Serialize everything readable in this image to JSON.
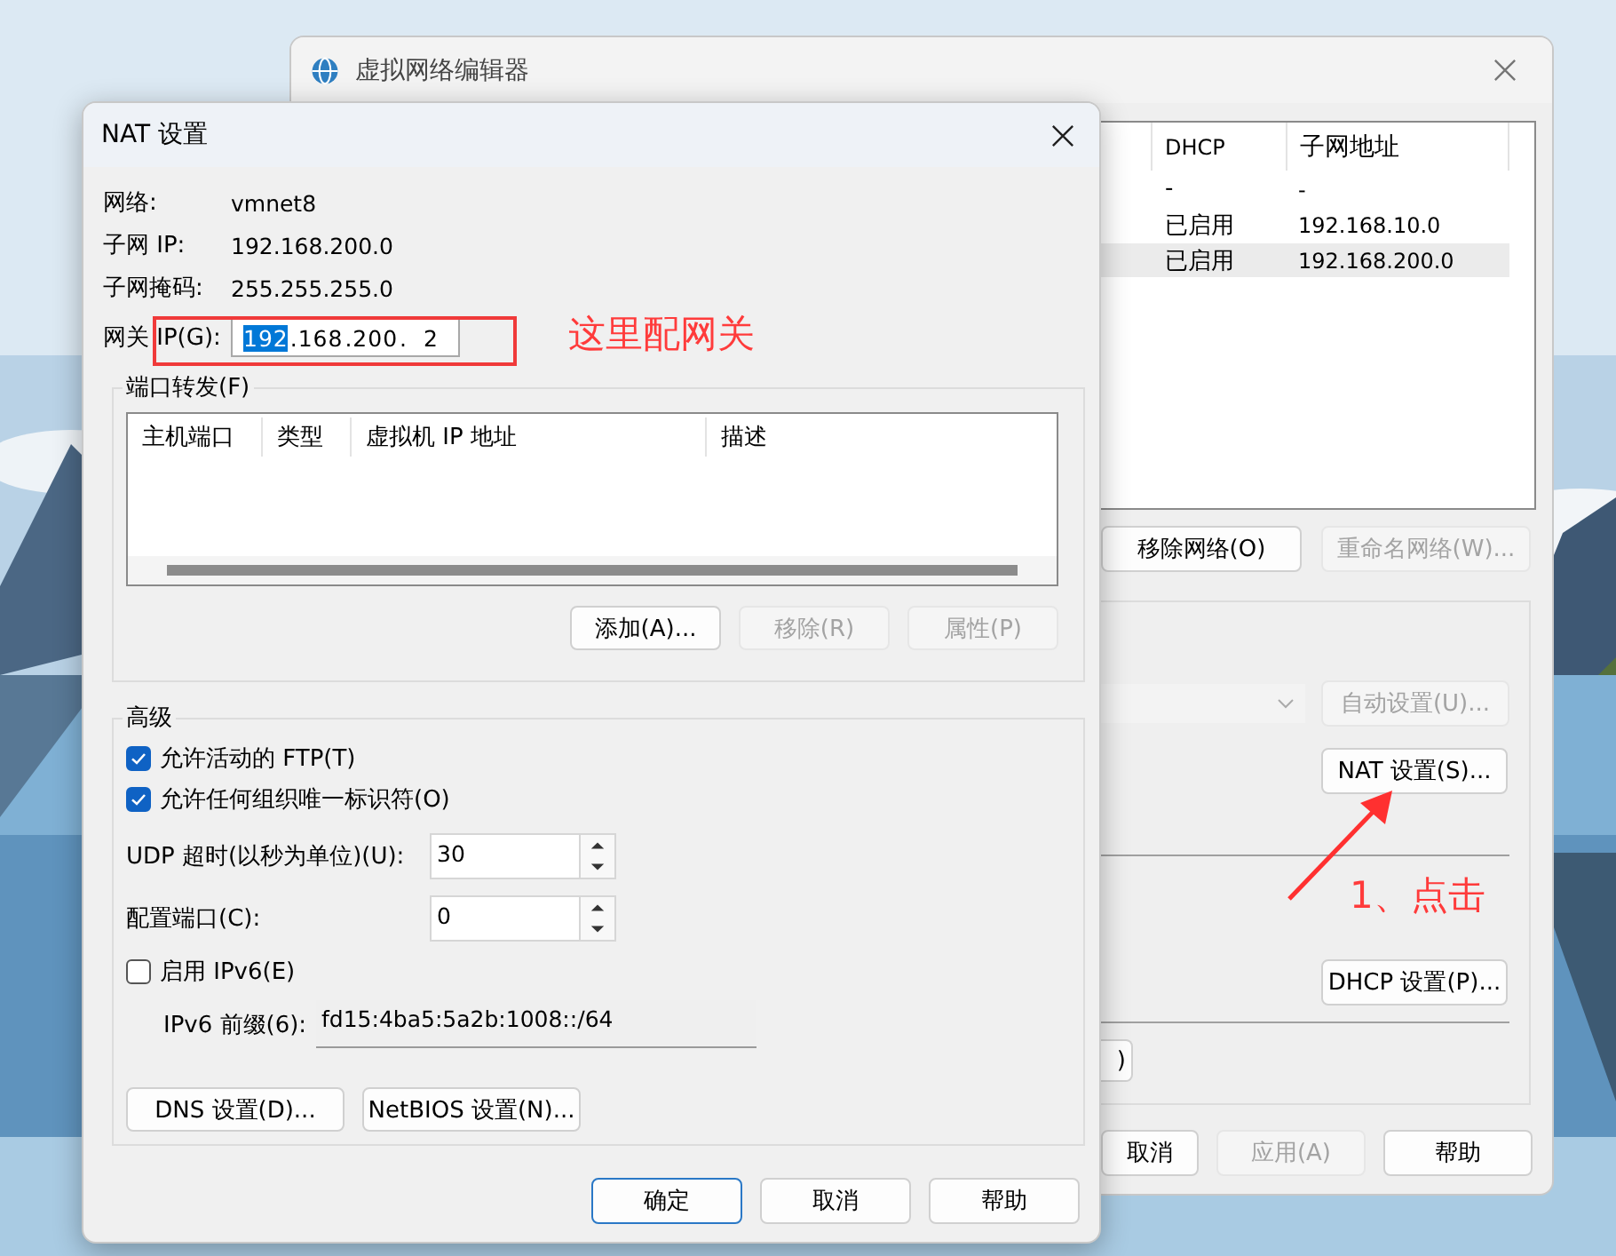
{
  "back_window": {
    "title": "虚拟网络编辑器",
    "table": {
      "columns": [
        "DHCP",
        "子网地址"
      ],
      "rows": [
        {
          "cells": [
            "-",
            "-"
          ],
          "selected": false
        },
        {
          "cells": [
            "已启用",
            "192.168.10.0"
          ],
          "selected": false
        },
        {
          "cells": [
            "已启用",
            "192.168.200.0"
          ],
          "selected": true
        }
      ]
    },
    "network_buttons": [
      {
        "label": "移除网络(O)",
        "disabled": false
      },
      {
        "label": "重命名网络(W)...",
        "disabled": true
      }
    ],
    "auto_button": {
      "label": "自动设置(U)...",
      "disabled": true
    },
    "nat_button": {
      "label": "NAT 设置(S)...",
      "disabled": false
    },
    "dhcp_button": {
      "label": "DHCP 设置(P)...",
      "disabled": false
    },
    "cut_button": {
      "label": ")",
      "disabled": false
    },
    "buttons": [
      {
        "label": "取消",
        "disabled": false
      },
      {
        "label": "应用(A)",
        "disabled": true
      },
      {
        "label": "帮助",
        "disabled": false
      }
    ]
  },
  "nat_dialog": {
    "title": "NAT 设置",
    "info": [
      {
        "label": "网络:",
        "value": "vmnet8"
      },
      {
        "label": "子网 IP:",
        "value": "192.168.200.0"
      },
      {
        "label": "子网掩码:",
        "value": "255.255.255.0"
      }
    ],
    "gateway": {
      "label": "网关 IP(G):",
      "parts": [
        {
          "text": "192",
          "selected": true
        },
        {
          "text": ".168",
          "selected": false
        },
        {
          "text": ".200",
          "selected": false
        },
        {
          "text": ".  2",
          "selected": false
        }
      ]
    },
    "port_forwarding": {
      "title": "端口转发(F)",
      "columns": [
        "主机端口",
        "类型",
        "虚拟机 IP 地址",
        "描述"
      ],
      "buttons": [
        {
          "label": "添加(A)...",
          "disabled": false
        },
        {
          "label": "移除(R)",
          "disabled": true
        },
        {
          "label": "属性(P)",
          "disabled": true
        }
      ]
    },
    "advanced": {
      "title": "高级",
      "options": [
        {
          "label": "允许活动的 FTP(T)",
          "checked": true
        },
        {
          "label": "允许任何组织唯一标识符(O)",
          "checked": true
        }
      ],
      "spinners": [
        {
          "label": "UDP 超时(以秒为单位)(U):",
          "value": "30"
        },
        {
          "label": "配置端口(C):",
          "value": "0"
        }
      ],
      "ipv6": {
        "label": "启用 IPv6(E)",
        "checked": false
      },
      "prefix": {
        "label": "IPv6 前缀(6):",
        "value": "fd15:4ba5:5a2b:1008::/64",
        "disabled": true
      },
      "buttons": [
        {
          "label": "DNS 设置(D)...",
          "disabled": false
        },
        {
          "label": "NetBIOS 设置(N)...",
          "disabled": false
        }
      ]
    },
    "buttons": [
      {
        "label": "确定",
        "default": true
      },
      {
        "label": "取消",
        "default": false
      },
      {
        "label": "帮助",
        "default": false
      }
    ]
  },
  "annotations": {
    "gateway_note": "这里配网关",
    "click_note": "1、点击"
  }
}
